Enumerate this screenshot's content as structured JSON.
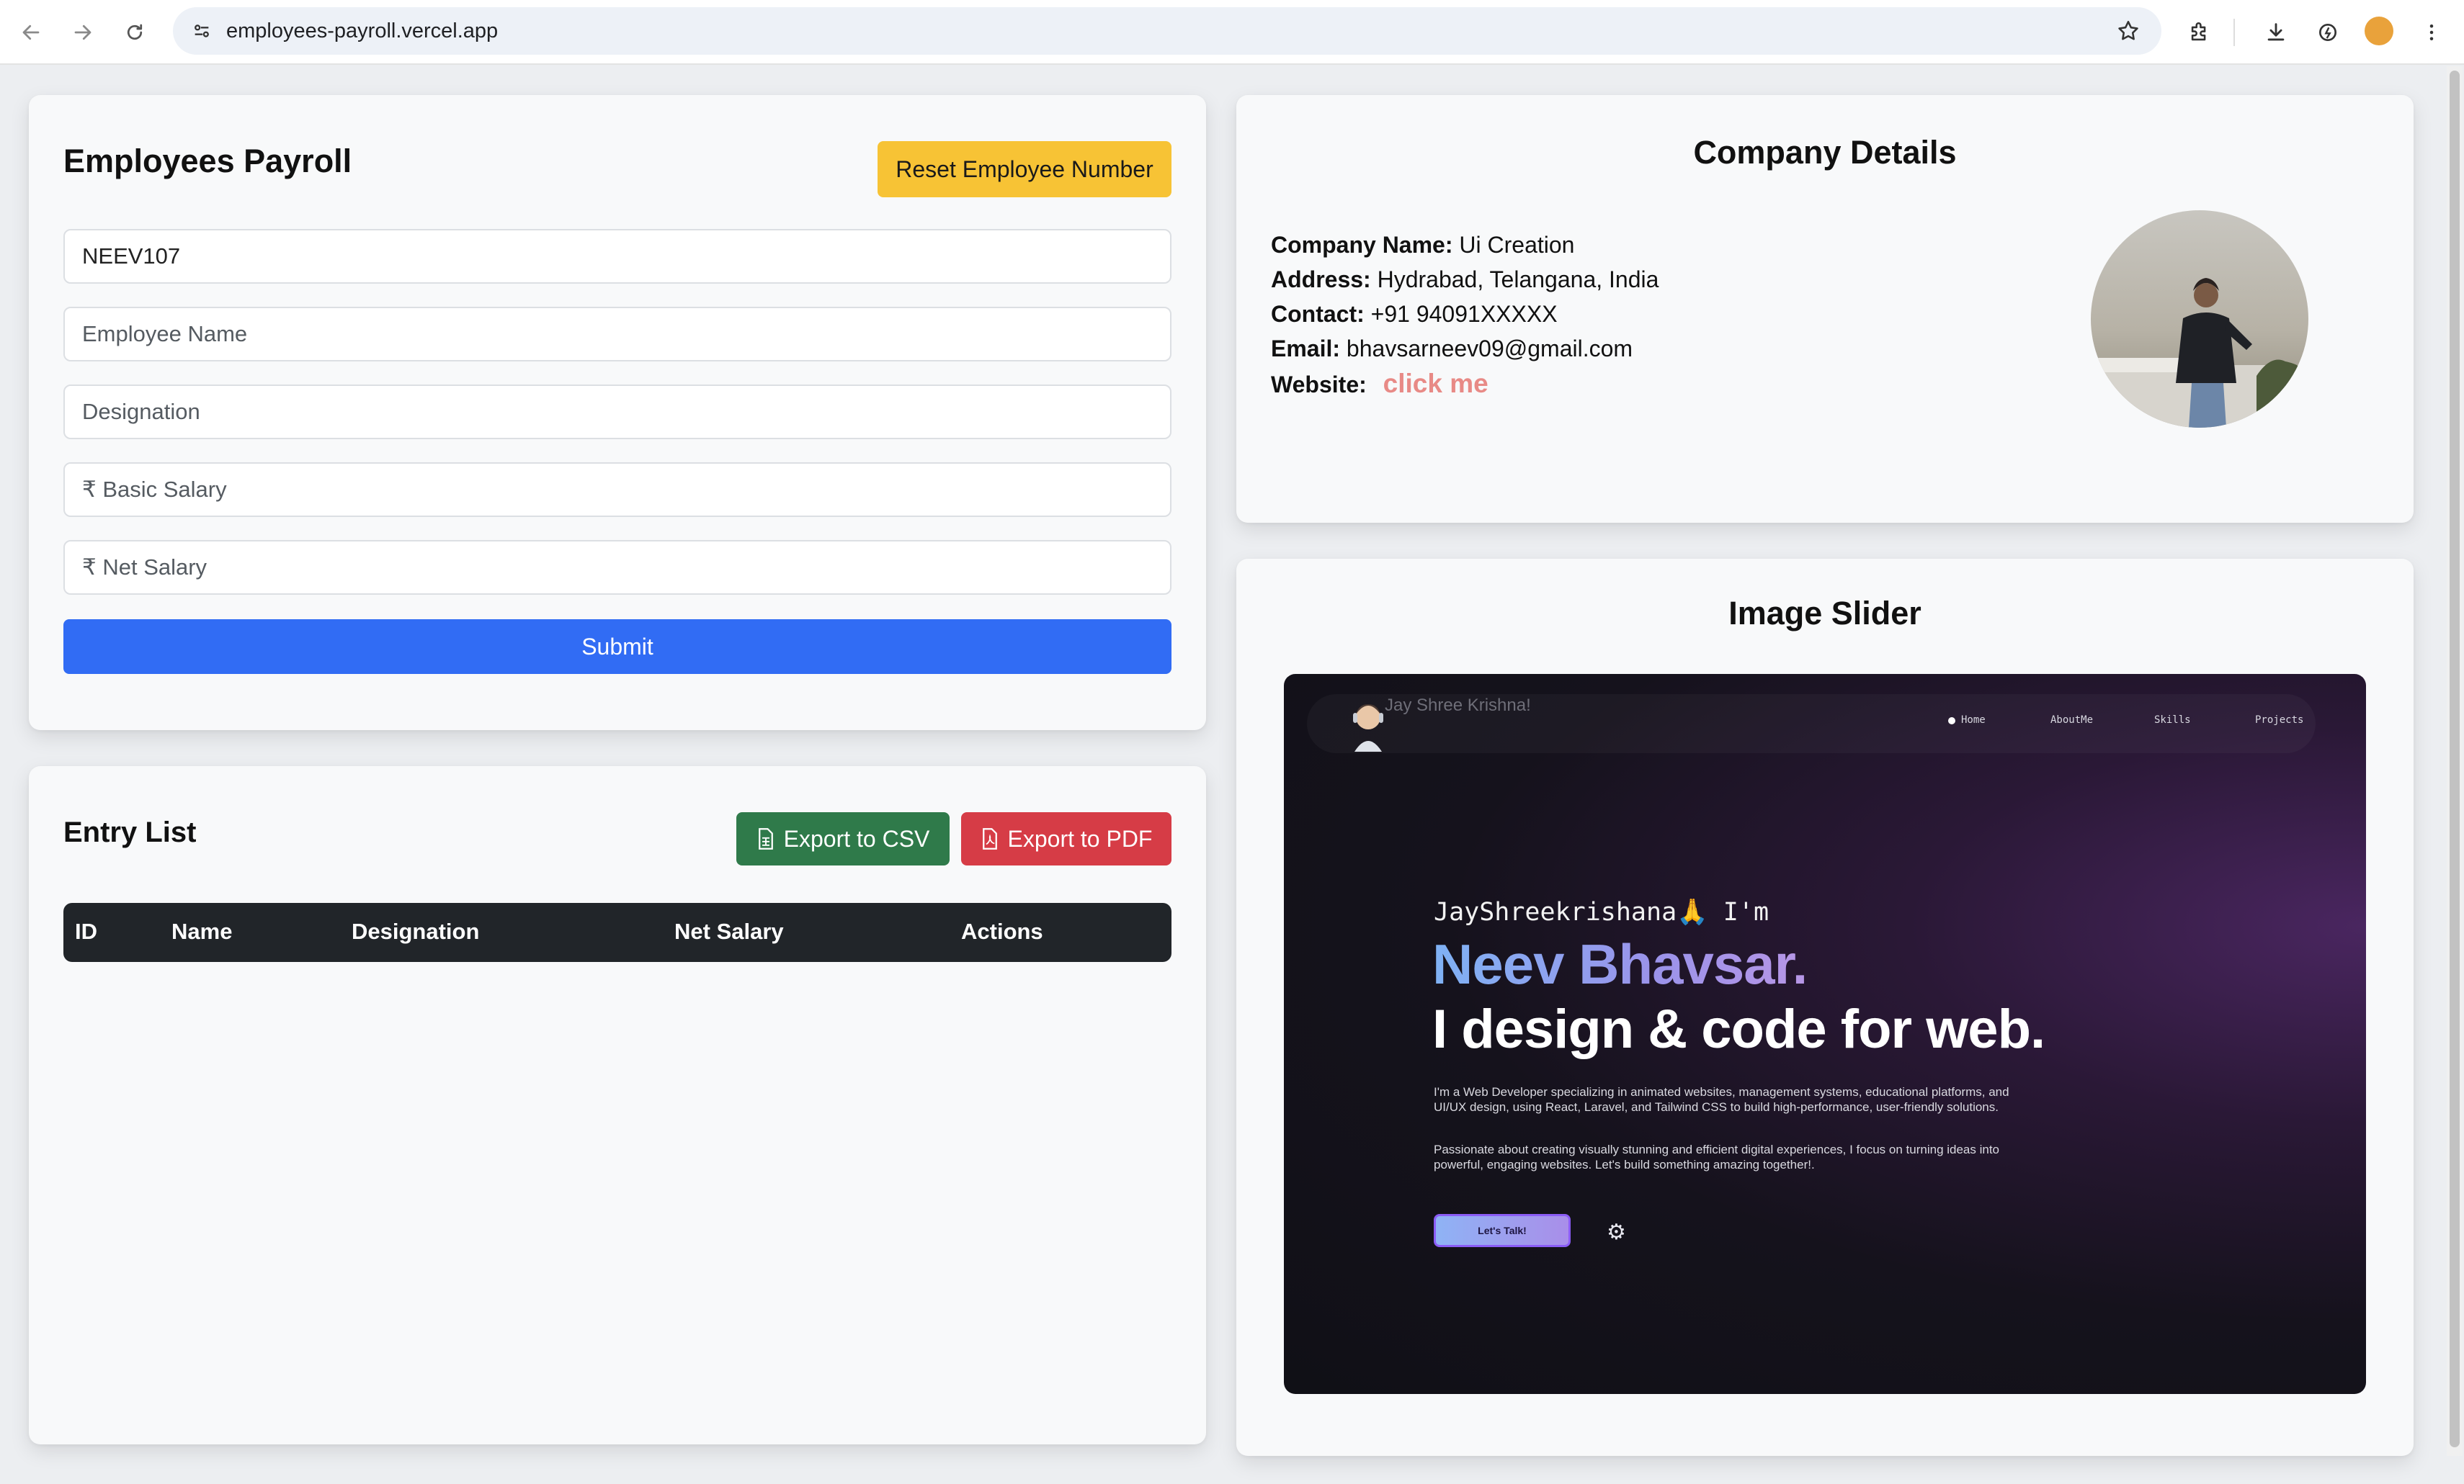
{
  "browser": {
    "url": "employees-payroll.vercel.app",
    "back_icon": "arrow-left-icon",
    "forward_icon": "arrow-right-icon",
    "reload_icon": "reload-icon",
    "bookmark_icon": "star-icon"
  },
  "payroll": {
    "title": "Employees Payroll",
    "reset_label": "Reset Employee Number",
    "employee_number": "NEEV107",
    "name_placeholder": "Employee Name",
    "designation_placeholder": "Designation",
    "basic_salary_placeholder": "₹ Basic Salary",
    "net_salary_placeholder": "₹ Net Salary",
    "submit_label": "Submit"
  },
  "entry_list": {
    "title": "Entry List",
    "export_csv_label": "Export to CSV",
    "export_pdf_label": "Export to PDF",
    "columns": [
      "ID",
      "Name",
      "Designation",
      "Net Salary",
      "Actions"
    ]
  },
  "company": {
    "title": "Company Details",
    "name_label": "Company Name:",
    "name_value": "Ui Creation",
    "address_label": "Address:",
    "address_value": "Hydrabad, Telangana, India",
    "contact_label": "Contact:",
    "contact_value": "+91 94091XXXXX",
    "email_label": "Email:",
    "email_value": "bhavsarneev09@gmail.com",
    "website_label": "Website:",
    "website_link": "click me"
  },
  "slider": {
    "title": "Image Slider",
    "brand": "Jay Shree Krishna!",
    "nav": [
      "Home",
      "AboutMe",
      "Skills",
      "Projects"
    ],
    "greeting": "JayShreekrishana🙏 I'm",
    "name": "Neev Bhavsar.",
    "tagline": "I design & code for web.",
    "para1": "I'm a Web Developer specializing in animated websites, management systems, educational platforms, and UI/UX design, using React, Laravel, and Tailwind CSS to build high-performance, user-friendly solutions.",
    "para2": "Passionate about creating visually stunning and efficient digital experiences, I focus on turning ideas into powerful, engaging websites. Let's build something amazing together!.",
    "cta": "Let's Talk!"
  },
  "colors": {
    "primary": "#316cf4",
    "warning": "#f7c335",
    "success": "#2f7a4a",
    "danger": "#d63c46",
    "link": "#e88a86",
    "table_header": "#212529"
  }
}
